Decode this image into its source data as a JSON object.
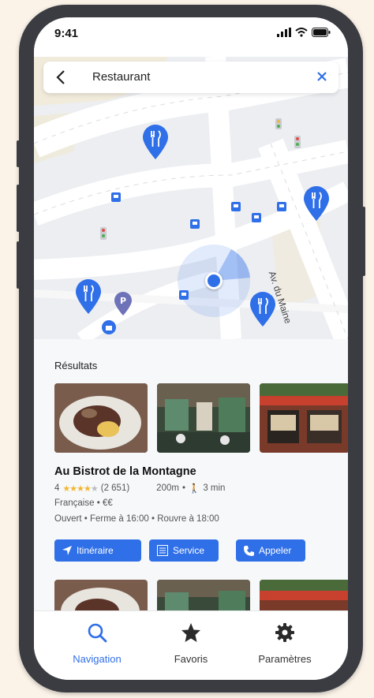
{
  "status": {
    "time": "9:41"
  },
  "search": {
    "query": "Restaurant"
  },
  "map": {
    "street_label": "Av. du Maine"
  },
  "results": {
    "title": "Résultats",
    "restaurant": {
      "name": "Au Bistrot de la Montagne",
      "rating": "4",
      "stars": 4,
      "reviews": "(2 651)",
      "distance": "200m",
      "walk_time": "3 min",
      "cuisine": "Française",
      "price": "€€",
      "open_status": "Ouvert",
      "closes": "Ferme à 16:00",
      "reopens": "Rouvre à 18:00"
    },
    "actions": {
      "route": "Itinéraire",
      "service": "Service",
      "call": "Appeler"
    }
  },
  "tabs": {
    "navigation": "Navigation",
    "favorites": "Favoris",
    "settings": "Paramètres"
  },
  "colors": {
    "accent": "#2f6fe8",
    "pin": "#2f6fe8",
    "parking": "#6e72b8"
  }
}
